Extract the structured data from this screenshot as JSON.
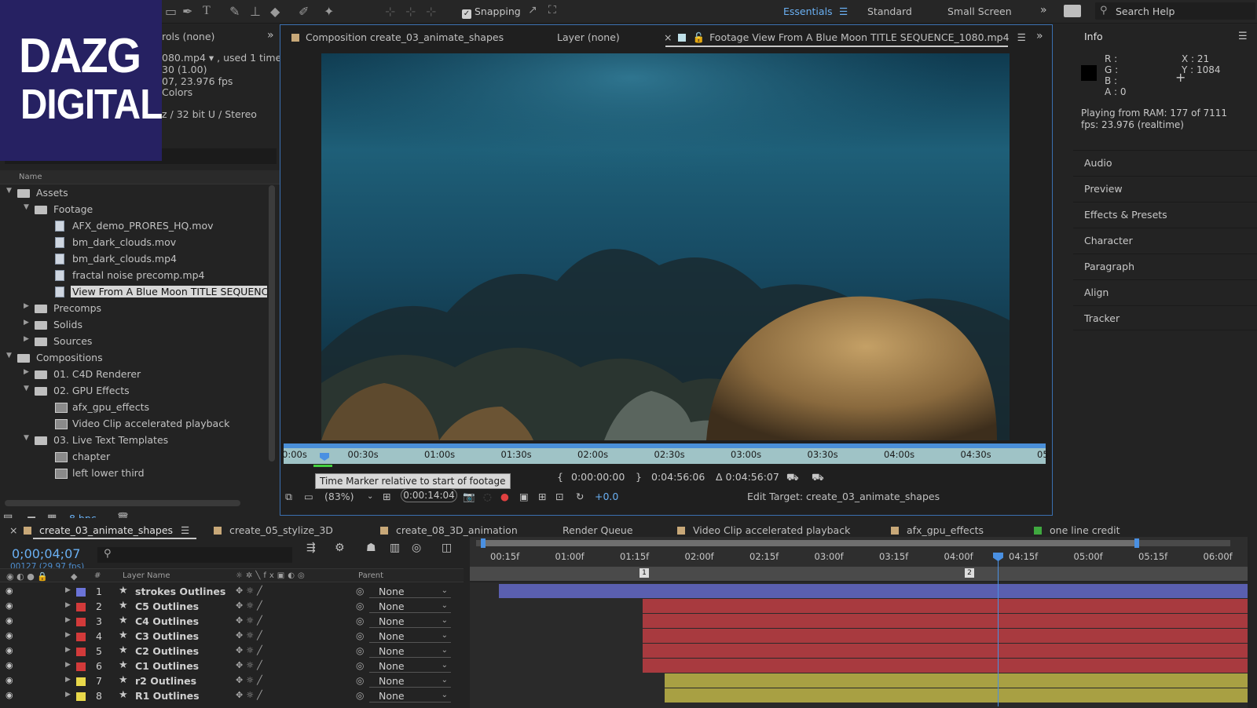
{
  "logo": {
    "line1": "DAZG",
    "line2": "DIGITAL"
  },
  "toolbar": {
    "snapping_label": "Snapping",
    "workspaces": [
      "Essentials",
      "Standard",
      "Small Screen"
    ],
    "active_workspace": "Essentials",
    "search_placeholder": "Search Help",
    "accent_color": "#6ab0f3"
  },
  "project": {
    "panel_tab": "rols (none)",
    "info_lines": [
      "080.mp4 ▾ , used 1 time",
      "30 (1.00)",
      "07, 23.976 fps",
      "Colors",
      "z / 32 bit U / Stereo"
    ],
    "column_name": "Name",
    "tree": [
      {
        "label": "Assets",
        "type": "folder",
        "level": 0,
        "open": true
      },
      {
        "label": "Footage",
        "type": "folder",
        "level": 1,
        "open": true
      },
      {
        "label": "AFX_demo_PRORES_HQ.mov",
        "type": "footage",
        "level": 2
      },
      {
        "label": "bm_dark_clouds.mov",
        "type": "footage",
        "level": 2
      },
      {
        "label": "bm_dark_clouds.mp4",
        "type": "footage",
        "level": 2
      },
      {
        "label": "fractal noise precomp.mp4",
        "type": "footage",
        "level": 2
      },
      {
        "label": "View From A Blue Moon TITLE SEQUENC",
        "type": "footage",
        "level": 2,
        "selected": true
      },
      {
        "label": "Precomps",
        "type": "folder",
        "level": 1,
        "open": false
      },
      {
        "label": "Solids",
        "type": "folder",
        "level": 1,
        "open": false
      },
      {
        "label": "Sources",
        "type": "folder",
        "level": 1,
        "open": false
      },
      {
        "label": "Compositions",
        "type": "folder",
        "level": 0,
        "open": true
      },
      {
        "label": "01. C4D Renderer",
        "type": "folder",
        "level": 1,
        "open": false
      },
      {
        "label": "02. GPU Effects",
        "type": "folder",
        "level": 1,
        "open": true
      },
      {
        "label": "afx_gpu_effects",
        "type": "comp",
        "level": 2
      },
      {
        "label": "Video Clip accelerated playback",
        "type": "comp",
        "level": 2
      },
      {
        "label": "03. Live Text Templates",
        "type": "folder",
        "level": 1,
        "open": true
      },
      {
        "label": "chapter",
        "type": "comp",
        "level": 2
      },
      {
        "label": "left lower third",
        "type": "comp",
        "level": 2
      }
    ],
    "bpc_label": "8 bpc"
  },
  "viewer": {
    "tab_composition": "Composition create_03_animate_shapes",
    "tab_layer": "Layer (none)",
    "tab_footage": "Footage View From A Blue Moon TITLE SEQUENCE_1080.mp4",
    "ruler_ticks": [
      "0:00s",
      "00:30s",
      "01:00s",
      "01:30s",
      "02:00s",
      "02:30s",
      "03:00s",
      "03:30s",
      "04:00s",
      "04:30s",
      "05"
    ],
    "tooltip": "Time Marker relative to start of footage",
    "in_point": "0:00:00:00",
    "out_point": "0:04:56:06",
    "duration": "Δ 0:04:56:07",
    "zoom": "(83%)",
    "current_time": "0:00:14:04",
    "exposure": "+0.0",
    "edit_target": "Edit Target: create_03_animate_shapes"
  },
  "info": {
    "title": "Info",
    "rgba": "R :\nG :\nB :\nA : 0",
    "xy": "X : 21\nY : 1084",
    "playing": "Playing from RAM: 177 of 7111",
    "fps": "fps: 23.976 (realtime)",
    "panels": [
      "Audio",
      "Preview",
      "Effects & Presets",
      "Character",
      "Paragraph",
      "Align",
      "Tracker"
    ]
  },
  "timeline": {
    "tabs": [
      {
        "label": "create_03_animate_shapes",
        "color": "#c8a878",
        "active": true
      },
      {
        "label": "create_05_stylize_3D",
        "color": "#c8a878"
      },
      {
        "label": "create_08_3D_animation",
        "color": "#c8a878"
      },
      {
        "label": "Render Queue",
        "color": ""
      },
      {
        "label": "Video Clip accelerated playback",
        "color": "#c8a878"
      },
      {
        "label": "afx_gpu_effects",
        "color": "#c8a878"
      },
      {
        "label": "one line credit",
        "color": "#3fa83f"
      }
    ],
    "timecode": "0;00;04;07",
    "frames": "00127 (29.97 fps)",
    "col_layer_name": "Layer Name",
    "col_parent": "Parent",
    "col_num": "#",
    "ticks": [
      "00:15f",
      "01:00f",
      "01:15f",
      "02:00f",
      "02:15f",
      "03:00f",
      "03:15f",
      "04:00f",
      "04:15f",
      "05:00f",
      "05:15f",
      "06:00f"
    ],
    "markers": [
      "1",
      "2"
    ],
    "layers": [
      {
        "num": "1",
        "name": "strokes Outlines",
        "label_color": "#6b74d8",
        "parent": "None",
        "bar_color": "#5a5fb0",
        "start_sec": 0.35
      },
      {
        "num": "2",
        "name": "C5 Outlines",
        "label_color": "#d23a3a",
        "parent": "None",
        "bar_color": "#a83a3f",
        "start_sec": 1.46
      },
      {
        "num": "3",
        "name": "C4 Outlines",
        "label_color": "#d23a3a",
        "parent": "None",
        "bar_color": "#a83a3f",
        "start_sec": 1.46
      },
      {
        "num": "4",
        "name": "C3 Outlines",
        "label_color": "#d23a3a",
        "parent": "None",
        "bar_color": "#a83a3f",
        "start_sec": 1.46
      },
      {
        "num": "5",
        "name": "C2 Outlines",
        "label_color": "#d23a3a",
        "parent": "None",
        "bar_color": "#a83a3f",
        "start_sec": 1.46
      },
      {
        "num": "6",
        "name": "C1 Outlines",
        "label_color": "#d23a3a",
        "parent": "None",
        "bar_color": "#a83a3f",
        "start_sec": 1.46
      },
      {
        "num": "7",
        "name": "r2 Outlines",
        "label_color": "#e8d84a",
        "parent": "None",
        "bar_color": "#a8a043",
        "start_sec": 1.63
      },
      {
        "num": "8",
        "name": "R1 Outlines",
        "label_color": "#e8d84a",
        "parent": "None",
        "bar_color": "#a8a043",
        "start_sec": 1.63
      }
    ]
  }
}
